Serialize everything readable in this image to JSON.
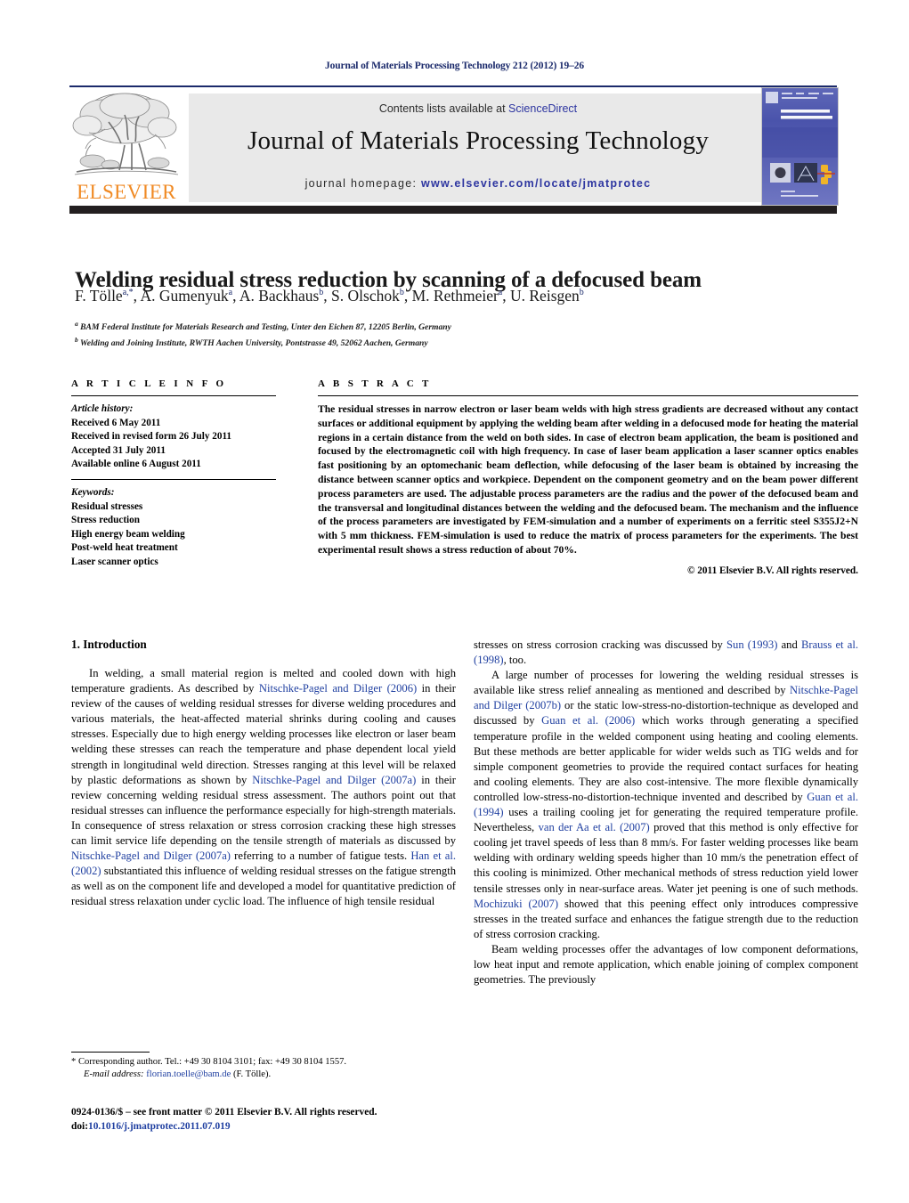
{
  "running_head": "Journal of Materials Processing Technology 212 (2012) 19–26",
  "masthead": {
    "contents_prefix": "Contents lists available at ",
    "sciencedirect": "ScienceDirect",
    "journal_title": "Journal of Materials Processing Technology",
    "homepage_label": "journal homepage: ",
    "homepage_url": "www.elsevier.com/locate/jmatprotec",
    "publisher_wordmark": "ELSEVIER",
    "publisher_color": "#f08a24",
    "link_color": "#2d35a0",
    "rule_color": "#1b2a6b",
    "cover_alt": "Journal of Materials Processing Technology cover"
  },
  "article": {
    "title": "Welding residual stress reduction by scanning of a defocused beam",
    "authors_html": "F. Tölle<sup>a,*</sup>, A. Gumenyuk<sup>a</sup>, A. Backhaus<sup>b</sup>, S. Olschok<sup>b</sup>, M. Rethmeier<sup>a</sup>, U. Reisgen<sup>b</sup>",
    "affiliations": [
      "BAM Federal Institute for Materials Research and Testing, Unter den Eichen 87, 12205 Berlin, Germany",
      "Welding and Joining Institute, RWTH Aachen University, Pontstrasse 49, 52062 Aachen, Germany"
    ]
  },
  "article_info": {
    "heading": "A R T I C L E   I N F O",
    "history_label": "Article history:",
    "history": [
      "Received 6 May 2011",
      "Received in revised form 26 July 2011",
      "Accepted 31 July 2011",
      "Available online 6 August 2011"
    ],
    "keywords_label": "Keywords:",
    "keywords": [
      "Residual stresses",
      "Stress reduction",
      "High energy beam welding",
      "Post-weld heat treatment",
      "Laser scanner optics"
    ]
  },
  "abstract": {
    "heading": "A B S T R A C T",
    "text": "The residual stresses in narrow electron or laser beam welds with high stress gradients are decreased without any contact surfaces or additional equipment by applying the welding beam after welding in a defocused mode for heating the material regions in a certain distance from the weld on both sides. In case of electron beam application, the beam is positioned and focused by the electromagnetic coil with high frequency. In case of laser beam application a laser scanner optics enables fast positioning by an optomechanic beam deflection, while defocusing of the laser beam is obtained by increasing the distance between scanner optics and workpiece. Dependent on the component geometry and on the beam power different process parameters are used. The adjustable process parameters are the radius and the power of the defocused beam and the transversal and longitudinal distances between the welding and the defocused beam. The mechanism and the influence of the process parameters are investigated by FEM-simulation and a number of experiments on a ferritic steel S355J2+N with 5 mm thickness. FEM-simulation is used to reduce the matrix of process parameters for the experiments. The best experimental result shows a stress reduction of about 70%.",
    "copyright": "© 2011 Elsevier B.V. All rights reserved."
  },
  "body": {
    "section_number_title": "1.  Introduction",
    "left_paragraphs_html": [
      "In welding, a small material region is melted and cooled down with high temperature gradients. As described by <span class=\"ref\">Nitschke-Pagel and Dilger (2006)</span> in their review of the causes of welding residual stresses for diverse welding procedures and various materials, the heat-affected material shrinks during cooling and causes stresses. Especially due to high energy welding processes like electron or laser beam welding these stresses can reach the temperature and phase dependent local yield strength in longitudinal weld direction. Stresses ranging at this level will be relaxed by plastic deformations as shown by <span class=\"ref\">Nitschke-Pagel and Dilger (2007a)</span> in their review concerning welding residual stress assessment. The authors point out that residual stresses can influence the performance especially for high-strength materials. In consequence of stress relaxation or stress corrosion cracking these high stresses can limit service life depending on the tensile strength of materials as discussed by <span class=\"ref\">Nitschke-Pagel and Dilger (2007a)</span> referring to a number of fatigue tests. <span class=\"ref\">Han et al. (2002)</span> substantiated this influence of welding residual stresses on the fatigue strength as well as on the component life and developed a model for quantitative prediction of residual stress relaxation under cyclic load. The influence of high tensile residual"
    ],
    "right_paragraphs_html": [
      "stresses on stress corrosion cracking was discussed by <span class=\"ref\">Sun (1993)</span> and <span class=\"ref\">Brauss et al. (1998)</span>, too.",
      "A large number of processes for lowering the welding residual stresses is available like stress relief annealing as mentioned and described by <span class=\"ref\">Nitschke-Pagel and Dilger (2007b)</span> or the static low-stress-no-distortion-technique as developed and discussed by <span class=\"ref\">Guan et al. (2006)</span> which works through generating a specified temperature profile in the welded component using heating and cooling elements. But these methods are better applicable for wider welds such as TIG welds and for simple component geometries to provide the required contact surfaces for heating and cooling elements. They are also cost-intensive. The more flexible dynamically controlled low-stress-no-distortion-technique invented and described by <span class=\"ref\">Guan et al. (1994)</span> uses a trailing cooling jet for generating the required temperature profile. Nevertheless, <span class=\"ref\">van der Aa et al. (2007)</span> proved that this method is only effective for cooling jet travel speeds of less than 8 mm/s. For faster welding processes like beam welding with ordinary welding speeds higher than 10 mm/s the penetration effect of this cooling is minimized. Other mechanical methods of stress reduction yield lower tensile stresses only in near-surface areas. Water jet peening is one of such methods. <span class=\"ref\">Mochizuki (2007)</span> showed that this peening effect only introduces compressive stresses in the treated surface and enhances the fatigue strength due to the reduction of stress corrosion cracking.",
      "Beam welding processes offer the advantages of low component deformations, low heat input and remote application, which enable joining of complex component geometries. The previously"
    ]
  },
  "footnote": {
    "corresponding_html": "* Corresponding author. Tel.: +49 30 8104 3101; fax: +49 30 8104 1557.",
    "email_label": "E-mail address:",
    "email": "florian.toelle@bam.de",
    "email_suffix": "(F. Tölle)."
  },
  "imprint": {
    "issn_line": "0924-0136/$ – see front matter © 2011 Elsevier B.V. All rights reserved.",
    "doi_prefix": "doi:",
    "doi": "10.1016/j.jmatprotec.2011.07.019"
  }
}
